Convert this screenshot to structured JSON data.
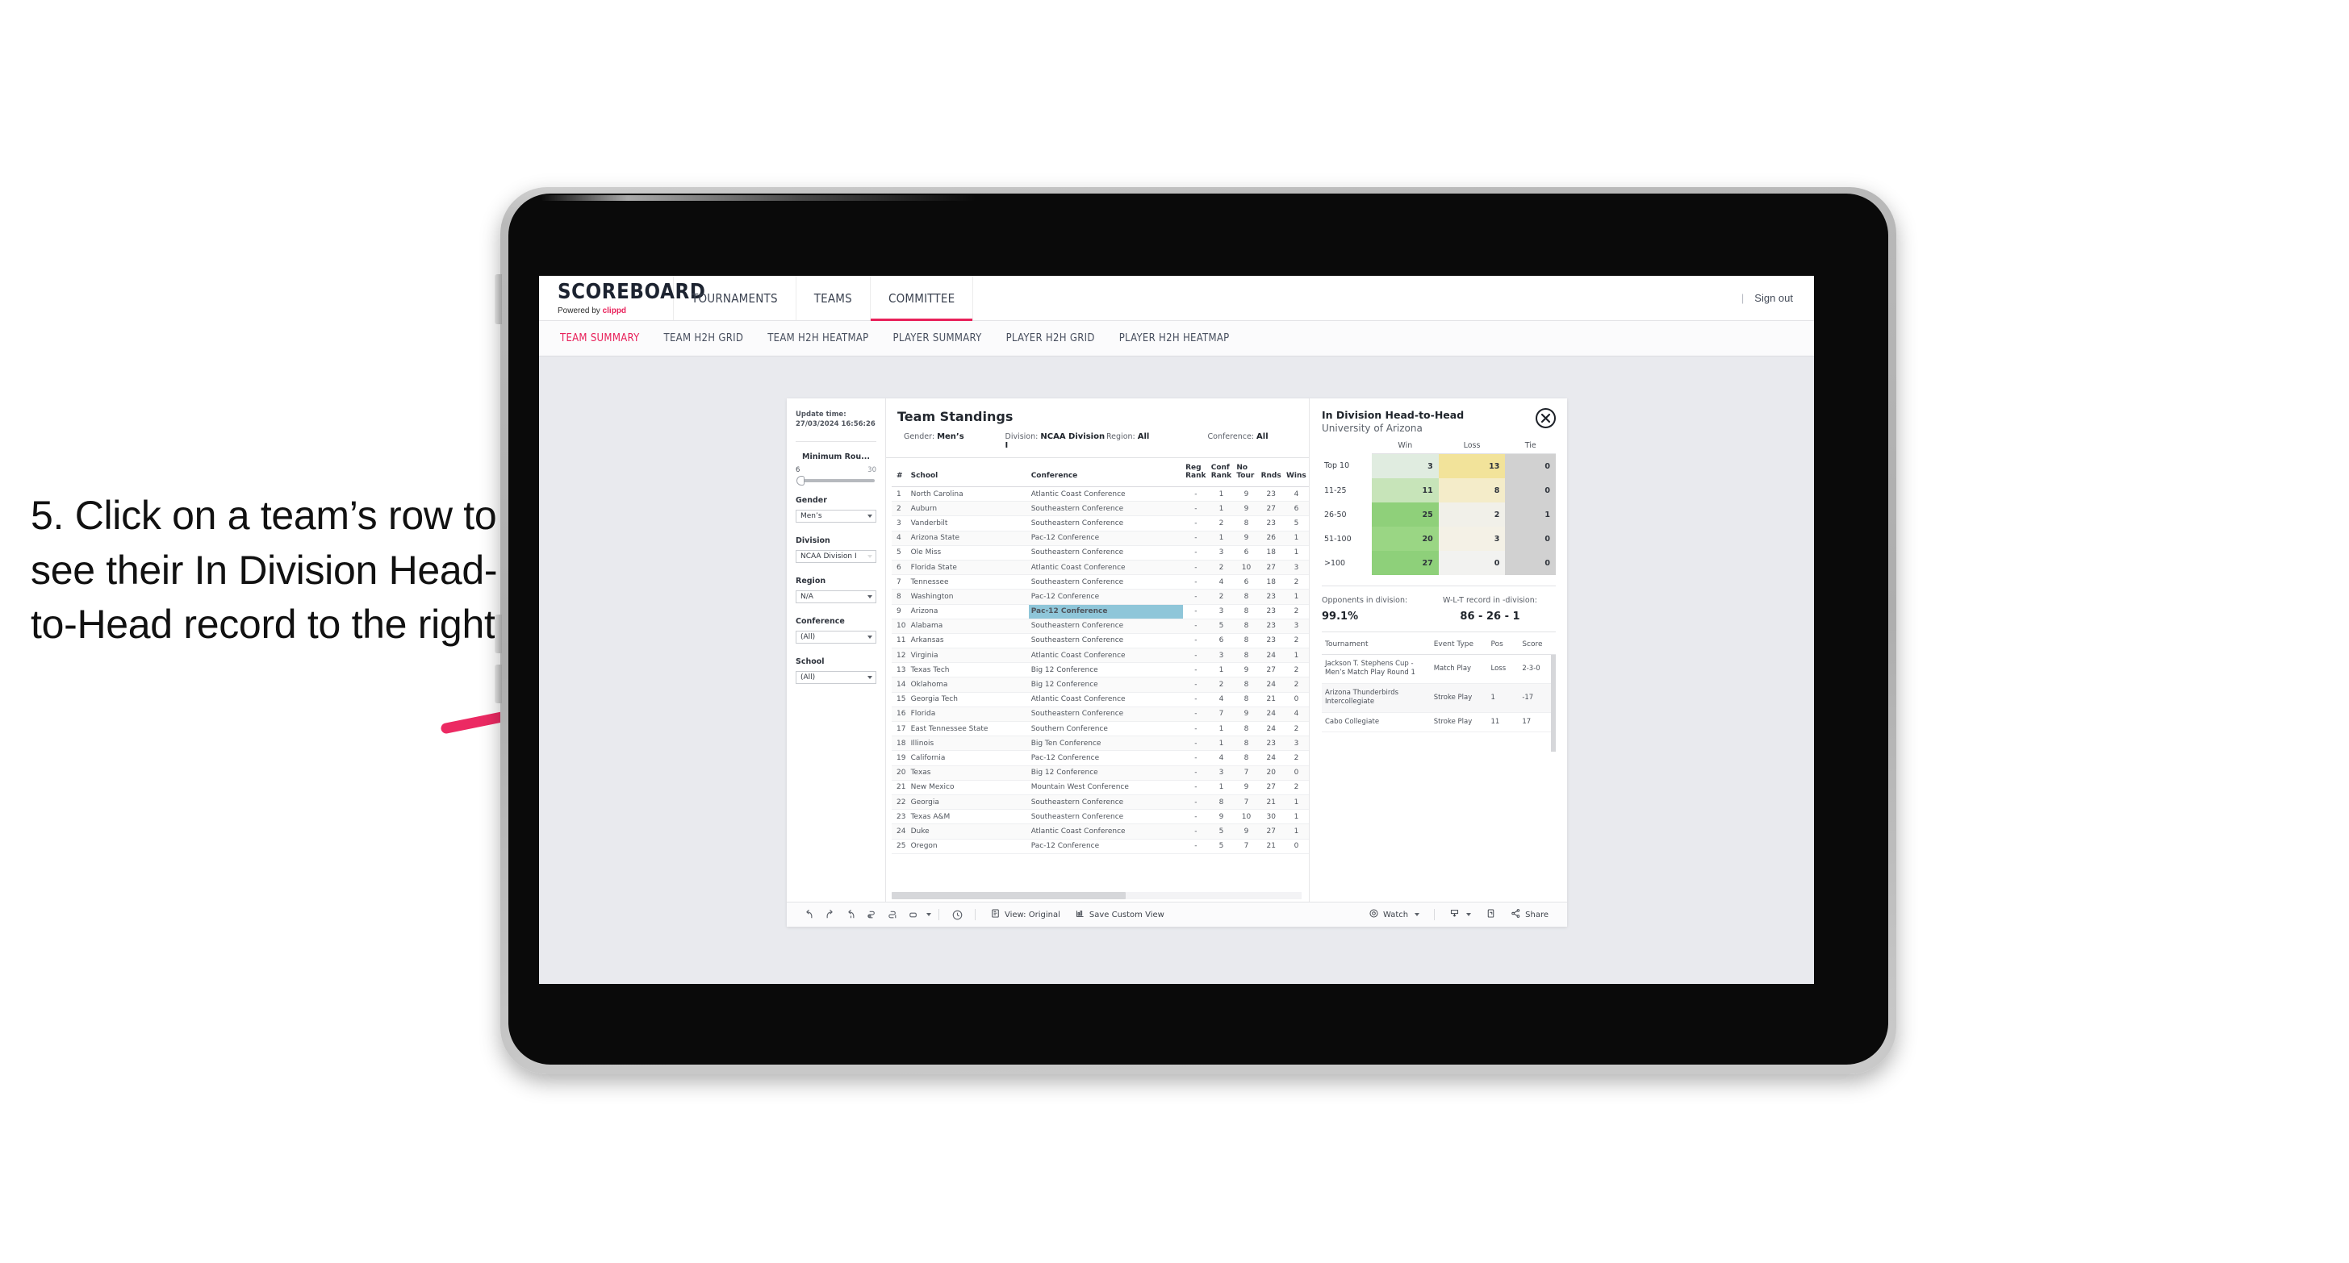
{
  "annotation": {
    "text": "5. Click on a team’s row to see their In Division Head-to-Head record to the right",
    "arrow_color": "#ec2a63"
  },
  "topnav": {
    "brand": "SCOREBOARD",
    "brand_prefix": "Powered by ",
    "brand_suffix": "clippd",
    "items": [
      {
        "label": "TOURNAMENTS",
        "active": false
      },
      {
        "label": "TEAMS",
        "active": false
      },
      {
        "label": "COMMITTEE",
        "active": true
      }
    ],
    "divider": "|",
    "signout": "Sign out"
  },
  "subnav": {
    "tabs": [
      {
        "label": "TEAM SUMMARY",
        "active": true
      },
      {
        "label": "TEAM H2H GRID",
        "active": false
      },
      {
        "label": "TEAM H2H HEATMAP",
        "active": false
      },
      {
        "label": "PLAYER SUMMARY",
        "active": false
      },
      {
        "label": "PLAYER H2H GRID",
        "active": false
      },
      {
        "label": "PLAYER H2H HEATMAP",
        "active": false
      }
    ]
  },
  "filters": {
    "update_time_label": "Update time:",
    "update_time_value": "27/03/2024 16:56:26",
    "min_rounds": {
      "title": "Minimum Rou...",
      "low": "6",
      "high": "30"
    },
    "groups": [
      {
        "title": "Gender",
        "value": "Men’s"
      },
      {
        "title": "Division",
        "value": "NCAA Division I"
      },
      {
        "title": "Region",
        "value": "N/A"
      },
      {
        "title": "Conference",
        "value": "(All)"
      },
      {
        "title": "School",
        "value": "(All)"
      }
    ]
  },
  "sheet": {
    "title": "Team Standings",
    "context": [
      {
        "label": "Gender:",
        "value": "Men’s"
      },
      {
        "label": "Division:",
        "value": "NCAA Division I"
      },
      {
        "label": "Region:",
        "value": "All"
      },
      {
        "label": "Conference:",
        "value": "All"
      }
    ],
    "columns": [
      "#",
      "School",
      "Conference",
      "Reg Rank",
      "Conf Rank",
      "No Tour",
      "Rnds",
      "Wins"
    ],
    "rows": [
      {
        "n": "1",
        "school": "North Carolina",
        "conf": "Atlantic Coast Conference",
        "reg": "-",
        "cr": "1",
        "nt": "9",
        "rnds": "23",
        "wins": "4"
      },
      {
        "n": "2",
        "school": "Auburn",
        "conf": "Southeastern Conference",
        "reg": "-",
        "cr": "1",
        "nt": "9",
        "rnds": "27",
        "wins": "6"
      },
      {
        "n": "3",
        "school": "Vanderbilt",
        "conf": "Southeastern Conference",
        "reg": "-",
        "cr": "2",
        "nt": "8",
        "rnds": "23",
        "wins": "5"
      },
      {
        "n": "4",
        "school": "Arizona State",
        "conf": "Pac-12 Conference",
        "reg": "-",
        "cr": "1",
        "nt": "9",
        "rnds": "26",
        "wins": "1"
      },
      {
        "n": "5",
        "school": "Ole Miss",
        "conf": "Southeastern Conference",
        "reg": "-",
        "cr": "3",
        "nt": "6",
        "rnds": "18",
        "wins": "1"
      },
      {
        "n": "6",
        "school": "Florida State",
        "conf": "Atlantic Coast Conference",
        "reg": "-",
        "cr": "2",
        "nt": "10",
        "rnds": "27",
        "wins": "3"
      },
      {
        "n": "7",
        "school": "Tennessee",
        "conf": "Southeastern Conference",
        "reg": "-",
        "cr": "4",
        "nt": "6",
        "rnds": "18",
        "wins": "2"
      },
      {
        "n": "8",
        "school": "Washington",
        "conf": "Pac-12 Conference",
        "reg": "-",
        "cr": "2",
        "nt": "8",
        "rnds": "23",
        "wins": "1"
      },
      {
        "n": "9",
        "school": "Arizona",
        "conf": "Pac-12 Conference",
        "reg": "-",
        "cr": "3",
        "nt": "8",
        "rnds": "23",
        "wins": "2",
        "highlight": true
      },
      {
        "n": "10",
        "school": "Alabama",
        "conf": "Southeastern Conference",
        "reg": "-",
        "cr": "5",
        "nt": "8",
        "rnds": "23",
        "wins": "3"
      },
      {
        "n": "11",
        "school": "Arkansas",
        "conf": "Southeastern Conference",
        "reg": "-",
        "cr": "6",
        "nt": "8",
        "rnds": "23",
        "wins": "2"
      },
      {
        "n": "12",
        "school": "Virginia",
        "conf": "Atlantic Coast Conference",
        "reg": "-",
        "cr": "3",
        "nt": "8",
        "rnds": "24",
        "wins": "1"
      },
      {
        "n": "13",
        "school": "Texas Tech",
        "conf": "Big 12 Conference",
        "reg": "-",
        "cr": "1",
        "nt": "9",
        "rnds": "27",
        "wins": "2"
      },
      {
        "n": "14",
        "school": "Oklahoma",
        "conf": "Big 12 Conference",
        "reg": "-",
        "cr": "2",
        "nt": "8",
        "rnds": "24",
        "wins": "2"
      },
      {
        "n": "15",
        "school": "Georgia Tech",
        "conf": "Atlantic Coast Conference",
        "reg": "-",
        "cr": "4",
        "nt": "8",
        "rnds": "21",
        "wins": "0"
      },
      {
        "n": "16",
        "school": "Florida",
        "conf": "Southeastern Conference",
        "reg": "-",
        "cr": "7",
        "nt": "9",
        "rnds": "24",
        "wins": "4"
      },
      {
        "n": "17",
        "school": "East Tennessee State",
        "conf": "Southern Conference",
        "reg": "-",
        "cr": "1",
        "nt": "8",
        "rnds": "24",
        "wins": "2"
      },
      {
        "n": "18",
        "school": "Illinois",
        "conf": "Big Ten Conference",
        "reg": "-",
        "cr": "1",
        "nt": "8",
        "rnds": "23",
        "wins": "3"
      },
      {
        "n": "19",
        "school": "California",
        "conf": "Pac-12 Conference",
        "reg": "-",
        "cr": "4",
        "nt": "8",
        "rnds": "24",
        "wins": "2"
      },
      {
        "n": "20",
        "school": "Texas",
        "conf": "Big 12 Conference",
        "reg": "-",
        "cr": "3",
        "nt": "7",
        "rnds": "20",
        "wins": "0"
      },
      {
        "n": "21",
        "school": "New Mexico",
        "conf": "Mountain West Conference",
        "reg": "-",
        "cr": "1",
        "nt": "9",
        "rnds": "27",
        "wins": "2"
      },
      {
        "n": "22",
        "school": "Georgia",
        "conf": "Southeastern Conference",
        "reg": "-",
        "cr": "8",
        "nt": "7",
        "rnds": "21",
        "wins": "1"
      },
      {
        "n": "23",
        "school": "Texas A&M",
        "conf": "Southeastern Conference",
        "reg": "-",
        "cr": "9",
        "nt": "10",
        "rnds": "30",
        "wins": "1"
      },
      {
        "n": "24",
        "school": "Duke",
        "conf": "Atlantic Coast Conference",
        "reg": "-",
        "cr": "5",
        "nt": "9",
        "rnds": "27",
        "wins": "1"
      },
      {
        "n": "25",
        "school": "Oregon",
        "conf": "Pac-12 Conference",
        "reg": "-",
        "cr": "5",
        "nt": "7",
        "rnds": "21",
        "wins": "0"
      }
    ]
  },
  "h2h": {
    "title": "In Division Head-to-Head",
    "subtitle": "University of Arizona",
    "close_icon": "close-icon",
    "columns": [
      "Win",
      "Loss",
      "Tie"
    ],
    "rows": [
      {
        "label": "Top 10",
        "win": "3",
        "loss": "13",
        "tie": "0",
        "win_color": "#e0ece0",
        "loss_color": "#f2e39a"
      },
      {
        "label": "11-25",
        "win": "11",
        "loss": "8",
        "tie": "0",
        "win_color": "#c7e4b9",
        "loss_color": "#f4ecc9"
      },
      {
        "label": "26-50",
        "win": "25",
        "loss": "2",
        "tie": "1",
        "win_color": "#8fd07a",
        "loss_color": "#f1f0e9"
      },
      {
        "label": "51-100",
        "win": "20",
        "loss": "3",
        "tie": "0",
        "win_color": "#9ad684",
        "loss_color": "#f4f1e6"
      },
      {
        "label": ">100",
        "win": "27",
        "loss": "0",
        "tie": "0",
        "win_color": "#8ed07a",
        "loss_color": "#f2f2f0"
      }
    ],
    "tie_color": "#d1d1d1",
    "stats": [
      {
        "label": "Opponents in division:",
        "value": "99.1%"
      },
      {
        "label": "W-L-T record in -division:",
        "value": "86 - 26 - 1"
      }
    ],
    "event_columns": [
      "Tournament",
      "Event Type",
      "Pos",
      "Score"
    ],
    "events": [
      {
        "name": "Jackson T. Stephens Cup - Men’s Match Play Round 1",
        "type": "Match Play",
        "pos": "Loss",
        "score": "2-3-0"
      },
      {
        "name": "Arizona Thunderbirds Intercollegiate",
        "type": "Stroke Play",
        "pos": "1",
        "score": "-17"
      },
      {
        "name": "Cabo Collegiate",
        "type": "Stroke Play",
        "pos": "11",
        "score": "17"
      }
    ]
  },
  "toolbar": {
    "icons": [
      "undo-icon",
      "redo-icon",
      "revert-icon",
      "refresh-icon",
      "pause-icon",
      "highlight-icon"
    ],
    "clock_icon": "clock-icon",
    "view_label": "View: Original",
    "view_icon": "view-icon",
    "save_label": "Save Custom View",
    "save_icon": "save-view-icon",
    "watch_label": "Watch",
    "watch_icon": "watch-icon",
    "download_icon": "download-icon",
    "fullscreen_icon": "fullscreen-icon",
    "share_label": "Share",
    "share_icon": "share-icon"
  }
}
